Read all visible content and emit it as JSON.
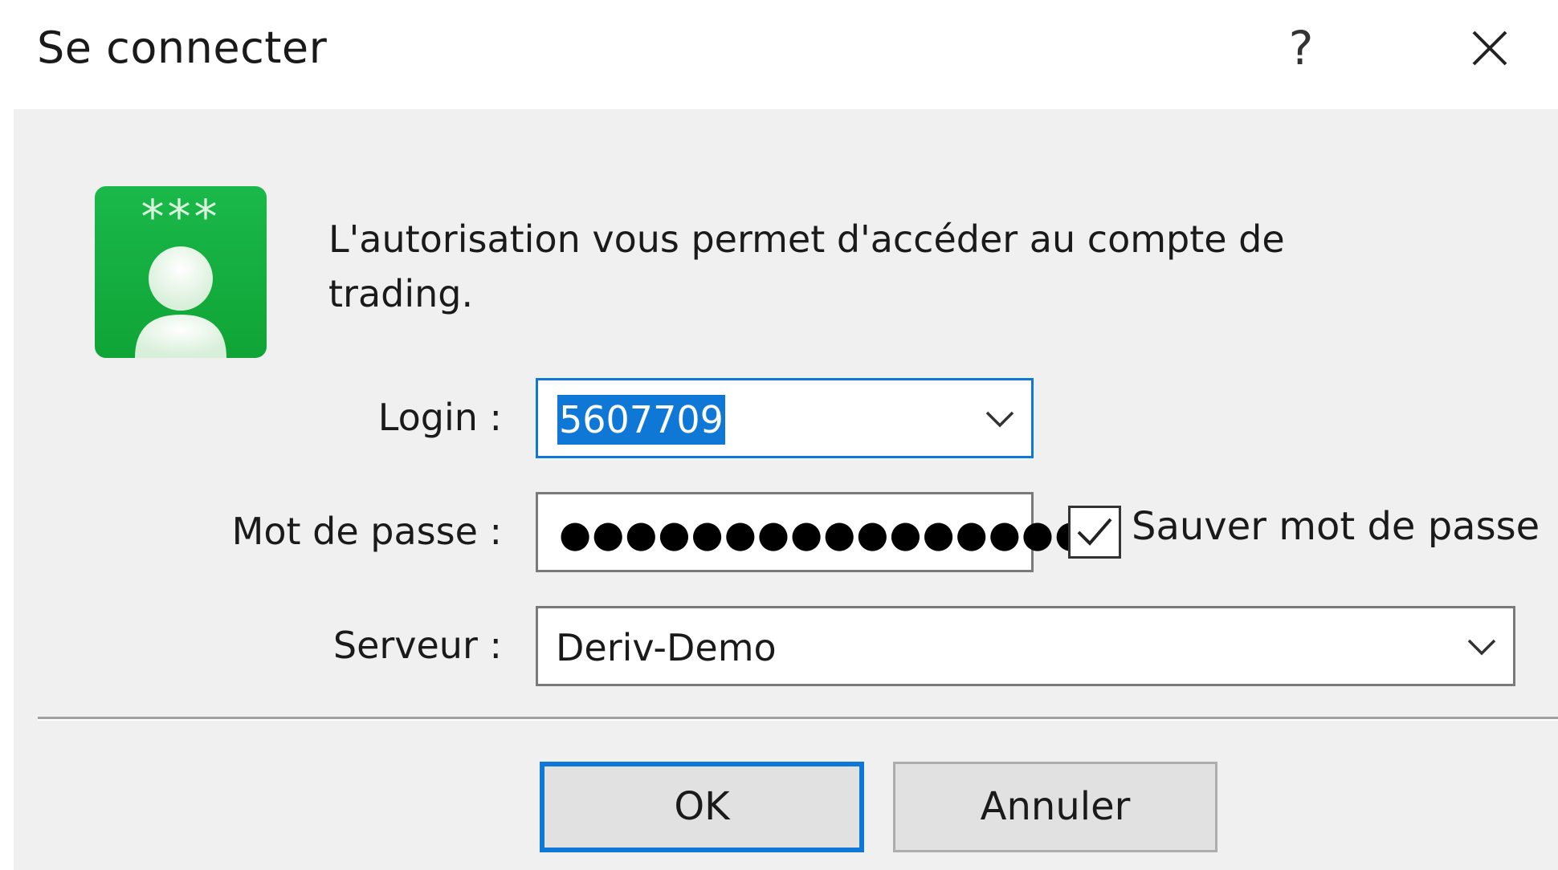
{
  "titlebar": {
    "title": "Se connecter",
    "help_label": "?"
  },
  "dialog": {
    "description": "L'autorisation vous permet d'accéder au compte de trading.",
    "avatar_icon": "user-key-icon",
    "avatar_asterisks": "***"
  },
  "login": {
    "label": "Login :",
    "value": "5607709",
    "dropdown_icon": "chevron-down-icon"
  },
  "password": {
    "label": "Mot de passe :",
    "masked_value": "●●●●●●●●●●●●●●●●●",
    "save_checked": true,
    "save_label": "Sauver mot de passe"
  },
  "server": {
    "label": "Serveur :",
    "value": "Deriv-Demo",
    "dropdown_icon": "chevron-down-icon"
  },
  "buttons": {
    "ok_label": "OK",
    "cancel_label": "Annuler"
  },
  "colors": {
    "accent": "#0f78d7",
    "avatar_green": "#15ad3e",
    "dialog_background": "#f0f0f0"
  }
}
